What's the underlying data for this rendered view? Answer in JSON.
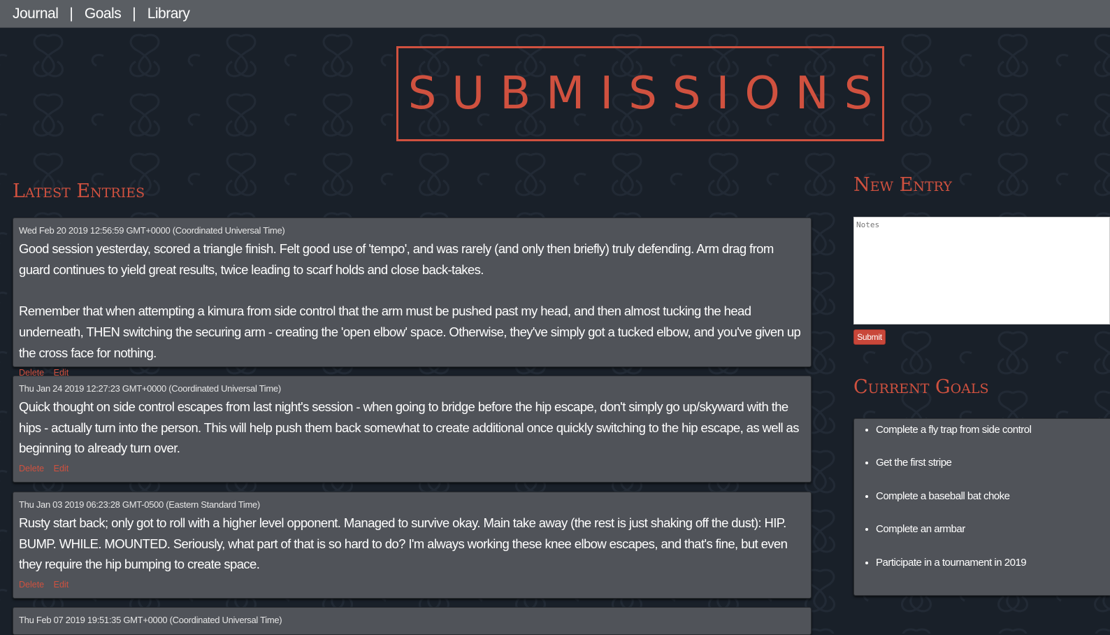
{
  "nav": {
    "journal": "Journal",
    "separator": "|",
    "goals": "Goals",
    "library": "Library"
  },
  "banner": {
    "title": "SUBMISSIONS"
  },
  "latest": {
    "heading": "Latest Entries",
    "entries": [
      {
        "date": "Wed Feb 20 2019 12:56:59 GMT+0000 (Coordinated Universal Time)",
        "text": "Good session yesterday, scored a triangle finish. Felt good use of 'tempo', and was rarely (and only then briefly) truly defending. Arm drag from guard continues to yield great results, twice leading to scarf holds and close back-takes.\n\nRemember that when attempting a kimura from side control that the arm must be pushed past my head, and then almost tucking the head underneath, THEN switching the securing arm - creating the 'open elbow' space. Otherwise, they've simply got a tucked elbow, and you've given up the cross face for nothing.",
        "delete_label": "Delete",
        "edit_label": "Edit"
      },
      {
        "date": "Thu Jan 24 2019 12:27:23 GMT+0000 (Coordinated Universal Time)",
        "text": "Quick thought on side control escapes from last night's session - when going to bridge before the hip escape, don't simply go up/skyward with the hips - actually turn into the person. This will help push them back somewhat to create additional once quickly switching to the hip escape, as well as beginning to already turn over.",
        "delete_label": "Delete",
        "edit_label": "Edit"
      },
      {
        "date": "Thu Jan 03 2019 06:23:28 GMT-0500 (Eastern Standard Time)",
        "text": "Rusty start back; only got to roll with a higher level opponent. Managed to survive okay. Main take away (the rest is just shaking off the dust): HIP. BUMP. WHILE. MOUNTED. Seriously, what part of that is so hard to do? I'm always working these knee elbow escapes, and that's fine, but even they require the hip bumping to create space.",
        "delete_label": "Delete",
        "edit_label": "Edit"
      },
      {
        "date": "Thu Feb 07 2019 19:51:35 GMT+0000 (Coordinated Universal Time)"
      }
    ]
  },
  "new_entry": {
    "heading": "New Entry",
    "placeholder": "Notes",
    "submit_label": "Submit"
  },
  "current_goals": {
    "heading": "Current Goals",
    "items": [
      "Complete a fly trap from side control",
      "Get the first stripe",
      "Complete a baseball bat choke",
      "Complete an armbar",
      "Participate in a tournament in 2019"
    ]
  },
  "colors": {
    "background": "#192029",
    "accent": "#d0513f",
    "card": "#505359",
    "nav": "#5a5e63"
  }
}
